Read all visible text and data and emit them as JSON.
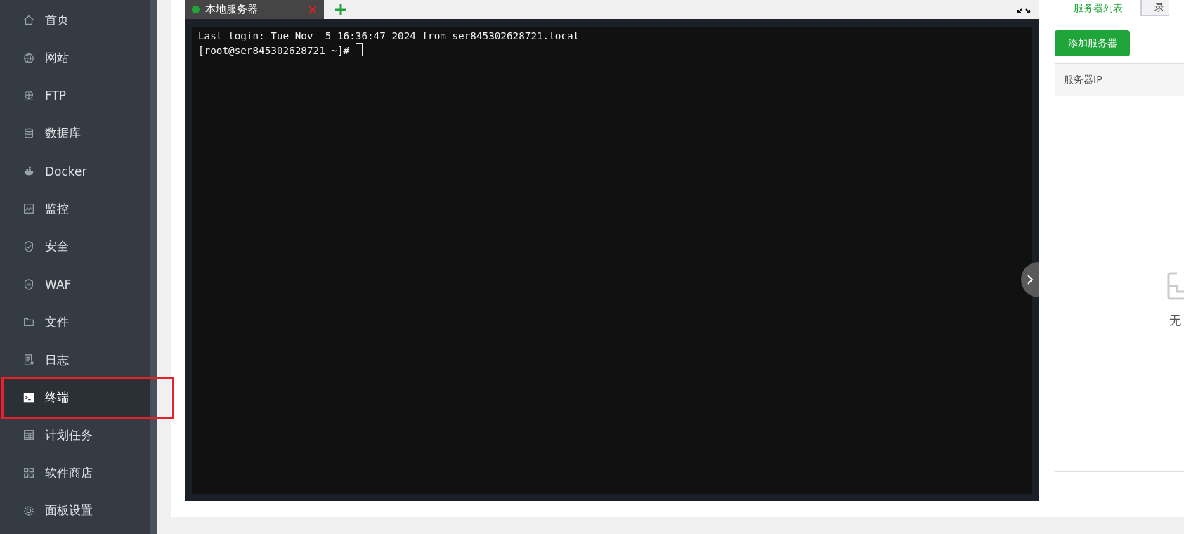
{
  "sidebar": {
    "items": [
      {
        "label": "首页",
        "selected": false
      },
      {
        "label": "网站",
        "selected": false
      },
      {
        "label": "FTP",
        "selected": false
      },
      {
        "label": "数据库",
        "selected": false
      },
      {
        "label": "Docker",
        "selected": false
      },
      {
        "label": "监控",
        "selected": false
      },
      {
        "label": "安全",
        "selected": false
      },
      {
        "label": "WAF",
        "selected": false
      },
      {
        "label": "文件",
        "selected": false
      },
      {
        "label": "日志",
        "selected": false
      },
      {
        "label": "终端",
        "selected": true
      },
      {
        "label": "计划任务",
        "selected": false
      },
      {
        "label": "软件商店",
        "selected": false
      },
      {
        "label": "面板设置",
        "selected": false
      }
    ]
  },
  "terminal": {
    "tabs": [
      {
        "label": "本地服务器",
        "connected": true
      }
    ],
    "lines": [
      "Last login: Tue Nov  5 16:36:47 2024 from ser845302628721.local",
      "[root@ser845302628721 ~]# "
    ]
  },
  "server_panel": {
    "tabs": [
      {
        "label": "服务器列表",
        "selected": true
      },
      {
        "label": "录",
        "selected": false
      }
    ],
    "add_button": "添加服务器",
    "table": {
      "columns": [
        "服务器IP"
      ]
    },
    "empty_text": "无"
  }
}
